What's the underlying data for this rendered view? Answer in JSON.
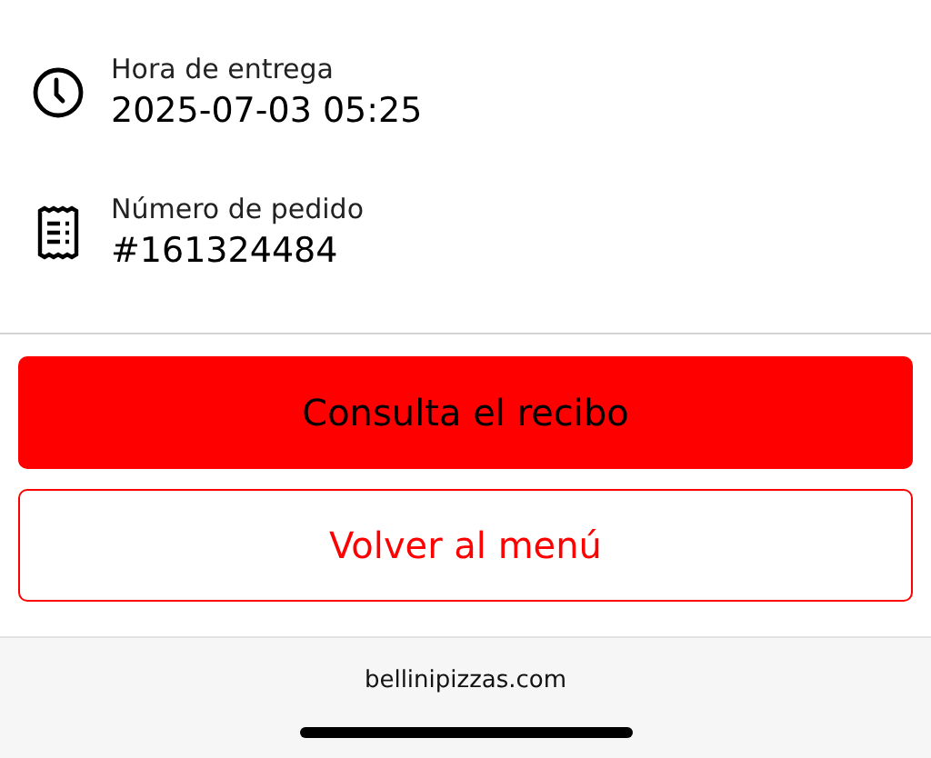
{
  "details": [
    {
      "kind": "clock",
      "label": "Hora de entrega",
      "value": "2025-07-03 05:25"
    },
    {
      "kind": "receipt",
      "label": "Número de pedido",
      "value": "#161324484"
    }
  ],
  "buttons": [
    {
      "kind": "primary",
      "label": "Consulta el recibo"
    },
    {
      "kind": "secondary",
      "label": "Volver al menú"
    }
  ],
  "browser_bar": {
    "url": "bellinipizzas.com"
  }
}
